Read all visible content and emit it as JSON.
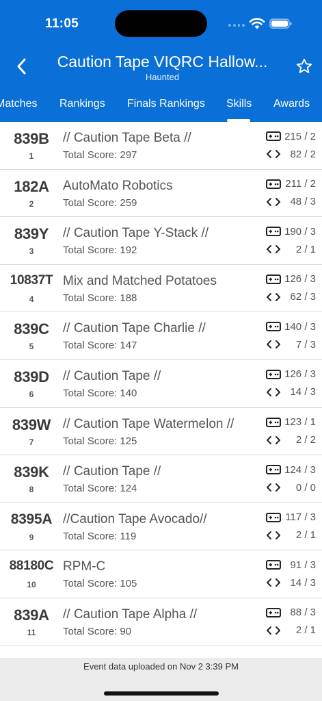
{
  "status_bar": {
    "time": "11:05"
  },
  "header": {
    "title": "Caution Tape VIQRC Hallow...",
    "subtitle": "Haunted",
    "back_icon": "chevron-left-icon",
    "favorite_icon": "star-outline-icon"
  },
  "tabs": [
    {
      "label": "Matches",
      "selected": false
    },
    {
      "label": "Rankings",
      "selected": false
    },
    {
      "label": "Finals Rankings",
      "selected": false
    },
    {
      "label": "Skills",
      "selected": true
    },
    {
      "label": "Awards",
      "selected": false
    }
  ],
  "teams": [
    {
      "number": "839B",
      "rank": "1",
      "name": "// Caution Tape Beta //",
      "total": "Total Score: 297",
      "driver": "215 / 2",
      "programming": "82 / 2"
    },
    {
      "number": "182A",
      "rank": "2",
      "name": "AutoMato Robotics",
      "total": "Total Score: 259",
      "driver": "211 / 2",
      "programming": "48 / 3"
    },
    {
      "number": "839Y",
      "rank": "3",
      "name": "// Caution Tape Y-Stack //",
      "total": "Total Score: 192",
      "driver": "190 / 3",
      "programming": "2 / 1"
    },
    {
      "number": "10837T",
      "rank": "4",
      "name": "Mix and Matched Potatoes",
      "total": "Total Score: 188",
      "driver": "126 / 3",
      "programming": "62 / 3"
    },
    {
      "number": "839C",
      "rank": "5",
      "name": "// Caution Tape Charlie //",
      "total": "Total Score: 147",
      "driver": "140 / 3",
      "programming": "7 / 3"
    },
    {
      "number": "839D",
      "rank": "6",
      "name": "// Caution Tape //",
      "total": "Total Score: 140",
      "driver": "126 / 3",
      "programming": "14 / 3"
    },
    {
      "number": "839W",
      "rank": "7",
      "name": "// Caution Tape Watermelon //",
      "total": "Total Score: 125",
      "driver": "123 / 1",
      "programming": "2 / 2"
    },
    {
      "number": "839K",
      "rank": "8",
      "name": "// Caution Tape //",
      "total": "Total Score: 124",
      "driver": "124 / 3",
      "programming": "0 / 0"
    },
    {
      "number": "8395A",
      "rank": "9",
      "name": "//Caution Tape Avocado//",
      "total": "Total Score: 119",
      "driver": "117 / 3",
      "programming": "2 / 1"
    },
    {
      "number": "88180C",
      "rank": "10",
      "name": "RPM-C",
      "total": "Total Score: 105",
      "driver": "91 / 3",
      "programming": "14 / 3"
    },
    {
      "number": "839A",
      "rank": "11",
      "name": "// Caution Tape Alpha //",
      "total": "Total Score: 90",
      "driver": "88 / 3",
      "programming": "2 / 1"
    }
  ],
  "skill_icons": {
    "driver": "gamepad-icon",
    "programming": "code-brackets-icon"
  },
  "footer": {
    "text": "Event data uploaded on Nov 2 3:39 PM"
  },
  "colors": {
    "header_bg": "#0a6fd6",
    "text": "#545456",
    "footer_bg": "#ebebeb"
  }
}
